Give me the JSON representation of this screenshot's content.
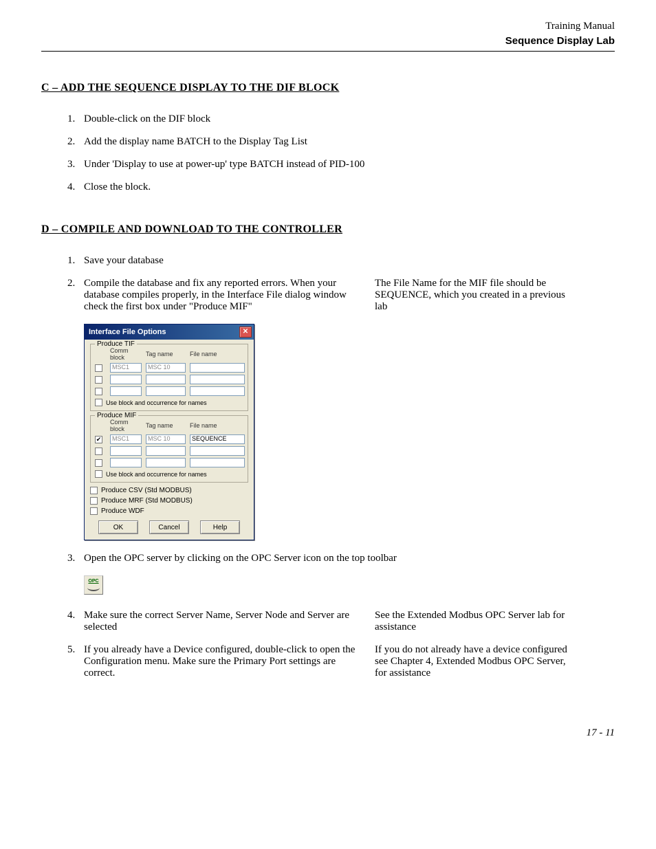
{
  "header": {
    "doc_type": "Training Manual",
    "lab_title": "Sequence Display Lab"
  },
  "section_c": {
    "heading": "C – ADD THE SEQUENCE DISPLAY TO THE DIF BLOCK",
    "items": [
      "Double-click on the DIF block",
      "Add the display name  BATCH   to the Display Tag List",
      "Under 'Display to use at power-up' type BATCH instead of PID-100",
      "Close the block."
    ]
  },
  "section_d": {
    "heading": "D – COMPILE AND DOWNLOAD TO THE CONTROLLER",
    "items": [
      "Save your database",
      "Compile the database and fix any reported errors.  When your database compiles properly, in the Interface File dialog window check the first box under \"Produce MIF\"",
      "Open the OPC server by clicking on the OPC Server icon on the top toolbar",
      "Make sure the correct Server Name, Server Node and Server are selected",
      "If you already have a Device configured, double-click to open the Configuration menu.  Make sure the Primary Port settings are correct."
    ],
    "sidenotes": {
      "1": "The File Name for the MIF file should be SEQUENCE, which you created in a previous lab",
      "3": "See the Extended Modbus OPC Server lab for assistance",
      "4": "If you do not already have a device configured see Chapter 4, Extended Modbus OPC Server, for assistance"
    }
  },
  "dialog": {
    "title": "Interface File Options",
    "group_tif": {
      "legend": "Produce TIF",
      "cols": {
        "comm": "Comm block",
        "tag": "Tag name",
        "file": "File name"
      },
      "rows": [
        {
          "checked": false,
          "comm": "MSC1",
          "tag": "MSC 10",
          "file": ""
        },
        {
          "checked": false,
          "comm": "",
          "tag": "",
          "file": ""
        },
        {
          "checked": false,
          "comm": "",
          "tag": "",
          "file": ""
        }
      ],
      "use_block_label": "Use block and occurrence for names"
    },
    "group_mif": {
      "legend": "Produce MIF",
      "cols": {
        "comm": "Comm block",
        "tag": "Tag name",
        "file": "File name"
      },
      "rows": [
        {
          "checked": true,
          "comm": "MSC1",
          "tag": "MSC 10",
          "file": "SEQUENCE"
        },
        {
          "checked": false,
          "comm": "",
          "tag": "",
          "file": ""
        },
        {
          "checked": false,
          "comm": "",
          "tag": "",
          "file": ""
        }
      ],
      "use_block_label": "Use block and occurrence for names"
    },
    "opts": {
      "csv": "Produce CSV (Std MODBUS)",
      "mrf": "Produce MRF (Std MODBUS)",
      "wdf": "Produce WDF"
    },
    "buttons": {
      "ok": "OK",
      "cancel": "Cancel",
      "help": "Help"
    }
  },
  "opc_icon_label": "OPC",
  "page_number": "17 - 11"
}
